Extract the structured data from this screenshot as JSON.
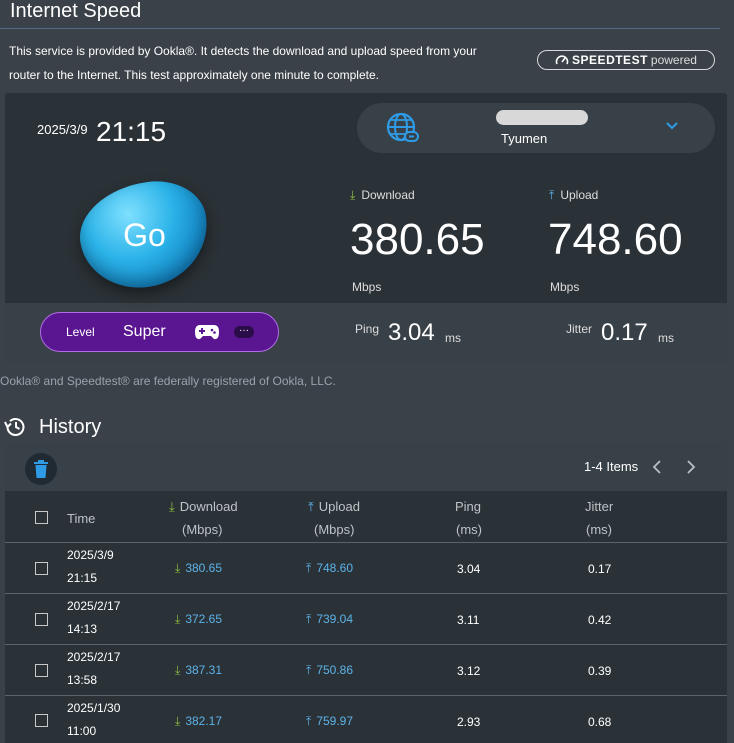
{
  "page": {
    "title": "Internet Speed",
    "description_line1": "This service is provided by Ookla®. It detects the download and upload speed from your",
    "description_line2": "router to the Internet. This test approximately one minute to complete.",
    "badge_brand": "SPEEDTEST",
    "badge_suffix": "powered"
  },
  "test": {
    "date": "2025/3/9",
    "time": "21:15",
    "server_city": "Tyumen",
    "go_label": "Go",
    "download_label": "Download",
    "download_value": "380.65",
    "download_unit": "Mbps",
    "upload_label": "Upload",
    "upload_value": "748.60",
    "upload_unit": "Mbps",
    "ping_label": "Ping",
    "ping_value": "3.04",
    "ping_unit": "ms",
    "jitter_label": "Jitter",
    "jitter_value": "0.17",
    "jitter_unit": "ms",
    "level_label": "Level",
    "level_value": "Super",
    "more_label": "···"
  },
  "footnote": "Ookla® and Speedtest® are federally registered of Ookla, LLC.",
  "history": {
    "title": "History",
    "items_label": "1-4 Items",
    "columns": {
      "time": "Time",
      "download": "Download",
      "download_unit": "(Mbps)",
      "upload": "Upload",
      "upload_unit": "(Mbps)",
      "ping": "Ping",
      "ping_unit": "(ms)",
      "jitter": "Jitter",
      "jitter_unit": "(ms)"
    },
    "rows": [
      {
        "date": "2025/3/9",
        "time": "21:15",
        "download": "380.65",
        "upload": "748.60",
        "ping": "3.04",
        "jitter": "0.17"
      },
      {
        "date": "2025/2/17",
        "time": "14:13",
        "download": "372.65",
        "upload": "739.04",
        "ping": "3.11",
        "jitter": "0.42"
      },
      {
        "date": "2025/2/17",
        "time": "13:58",
        "download": "387.31",
        "upload": "750.86",
        "ping": "3.12",
        "jitter": "0.39"
      },
      {
        "date": "2025/1/30",
        "time": "11:00",
        "download": "382.17",
        "upload": "759.97",
        "ping": "2.93",
        "jitter": "0.68"
      }
    ]
  },
  "colors": {
    "accent": "#5cb3ea",
    "download_arrow": "#8fbf3f",
    "level_bg": "#5a1590"
  },
  "icons": {
    "globe": "globe-link-icon",
    "chevron": "chevron-down-icon",
    "gamepad": "gamepad-icon",
    "history": "history-clock-icon",
    "trash": "trash-icon"
  }
}
